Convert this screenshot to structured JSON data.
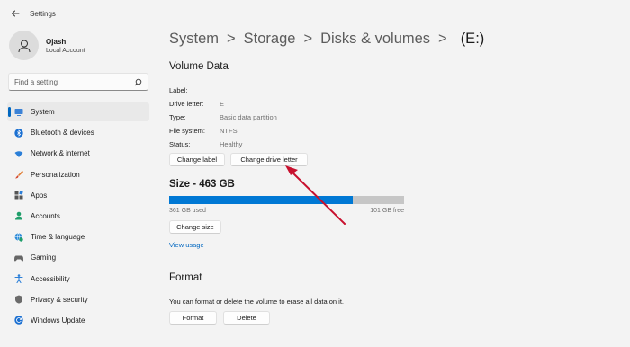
{
  "app": {
    "title": "Settings"
  },
  "user": {
    "name": "Ojash",
    "account_type": "Local Account"
  },
  "search": {
    "placeholder": "Find a setting"
  },
  "sidebar": {
    "items": [
      {
        "label": "System",
        "icon": "monitor-icon",
        "active": true
      },
      {
        "label": "Bluetooth & devices",
        "icon": "bluetooth-icon"
      },
      {
        "label": "Network & internet",
        "icon": "wifi-icon"
      },
      {
        "label": "Personalization",
        "icon": "brush-icon"
      },
      {
        "label": "Apps",
        "icon": "apps-icon"
      },
      {
        "label": "Accounts",
        "icon": "person-icon"
      },
      {
        "label": "Time & language",
        "icon": "globe-clock-icon"
      },
      {
        "label": "Gaming",
        "icon": "gamepad-icon"
      },
      {
        "label": "Accessibility",
        "icon": "accessibility-icon"
      },
      {
        "label": "Privacy & security",
        "icon": "shield-icon"
      },
      {
        "label": "Windows Update",
        "icon": "update-icon"
      }
    ]
  },
  "breadcrumb": {
    "items": [
      "System",
      "Storage",
      "Disks & volumes"
    ],
    "separator": ">",
    "current": "(E:)"
  },
  "volume_data": {
    "title": "Volume Data",
    "properties": [
      {
        "key": "Label:",
        "value": ""
      },
      {
        "key": "Drive letter:",
        "value": "E"
      },
      {
        "key": "Type:",
        "value": "Basic data partition"
      },
      {
        "key": "File system:",
        "value": "NTFS"
      },
      {
        "key": "Status:",
        "value": "Healthy"
      }
    ],
    "change_label_button": "Change label",
    "change_drive_letter_button": "Change drive letter"
  },
  "size": {
    "title": "Size - 463 GB",
    "used_label": "361 GB used",
    "free_label": "101 GB free",
    "used_fraction": 0.78,
    "change_size_button": "Change size",
    "view_usage_link": "View usage"
  },
  "format": {
    "title": "Format",
    "description": "You can format or delete the volume to erase all data on it.",
    "format_button": "Format",
    "delete_button": "Delete"
  },
  "colors": {
    "accent": "#0078d4",
    "annotation_arrow": "#c8102e"
  }
}
